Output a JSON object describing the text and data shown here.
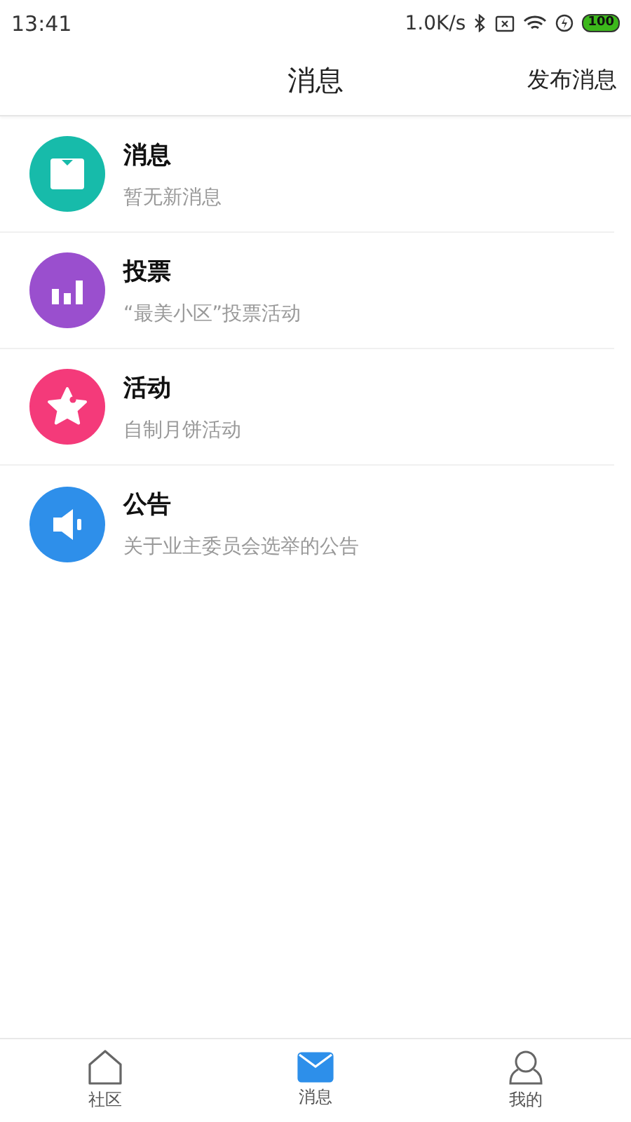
{
  "status_bar": {
    "time": "13:41",
    "speed": "1.0K/s",
    "battery": "100"
  },
  "header": {
    "title": "消息",
    "action": "发布消息"
  },
  "items": [
    {
      "kind": "message",
      "color": "#17bbaa",
      "title": "消息",
      "subtitle": "暂无新消息"
    },
    {
      "kind": "vote",
      "color": "#9a4fce",
      "title": "投票",
      "subtitle": "“最美小区”投票活动"
    },
    {
      "kind": "event",
      "color": "#f43a7a",
      "title": "活动",
      "subtitle": "自制月饼活动"
    },
    {
      "kind": "notice",
      "color": "#2e8fea",
      "title": "公告",
      "subtitle": "关于业主委员会选举的公告"
    }
  ],
  "tabs": [
    {
      "kind": "home",
      "label": "社区",
      "selected": false
    },
    {
      "kind": "mail",
      "label": "消息",
      "selected": true
    },
    {
      "kind": "user",
      "label": "我的",
      "selected": false
    }
  ]
}
